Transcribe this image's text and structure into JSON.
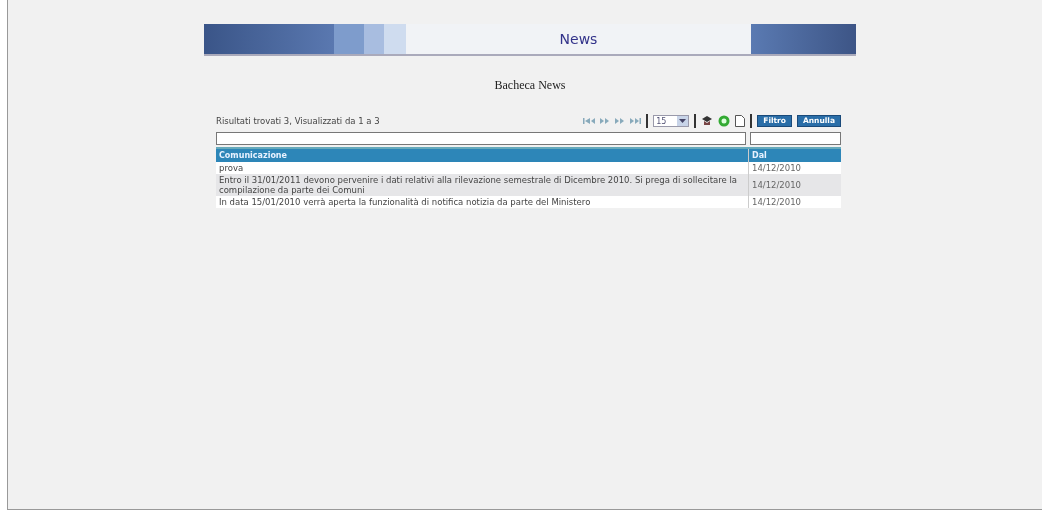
{
  "header": {
    "title": "News"
  },
  "subtitle": "Bacheca News",
  "toolbar": {
    "results": "Risultati trovati 3, Visualizzati da 1 a 3",
    "page_size": "15",
    "buttons": [
      "Filtro",
      "Annulla"
    ]
  },
  "table": {
    "columns": [
      "Comunicazione",
      "Dal"
    ],
    "rows": [
      {
        "cells": [
          "prova",
          "14/12/2010"
        ]
      },
      {
        "cells": [
          "Entro il 31/01/2011 devono pervenire i dati relativi alla rilevazione semestrale di Dicembre 2010. Si prega di sollecitare la compilazione da parte dei Comuni",
          "14/12/2010"
        ]
      },
      {
        "cells": [
          "In data 15/01/2010 verrà aperta la funzionalità di notifica notizia da parte del Ministero",
          "14/12/2010"
        ]
      }
    ]
  }
}
